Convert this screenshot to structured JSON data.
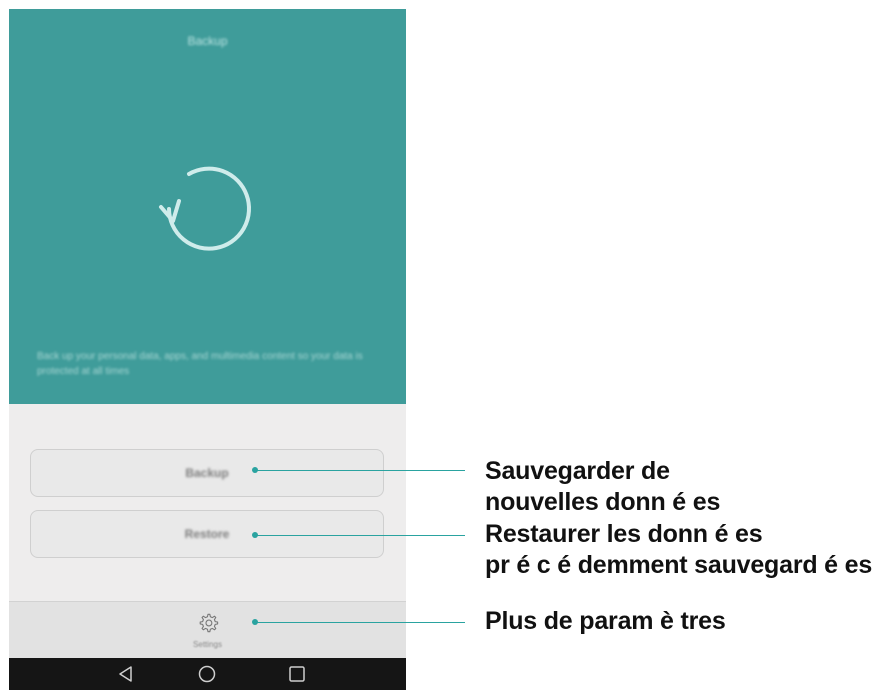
{
  "app": {
    "title": "Backup",
    "description": "Back up your personal data, apps, and multimedia content so your data is protected at all times"
  },
  "buttons": {
    "backup_label": "Backup",
    "restore_label": "Restore"
  },
  "settings": {
    "label": "Settings",
    "icon": "gear-icon"
  },
  "navigation": {
    "back_icon": "back-triangle-icon",
    "home_icon": "home-circle-icon",
    "recent_icon": "recent-square-icon"
  },
  "callouts": {
    "backup": [
      "Sauvegarder de",
      "nouvelles donn é es"
    ],
    "restore": [
      "Restaurer les donn é es",
      "pr é c é demment sauvegard é es"
    ],
    "settings": [
      "Plus de param è tres"
    ]
  },
  "colors": {
    "hero_background": "#3f9c9a",
    "callout_line": "#2aa3a0"
  }
}
